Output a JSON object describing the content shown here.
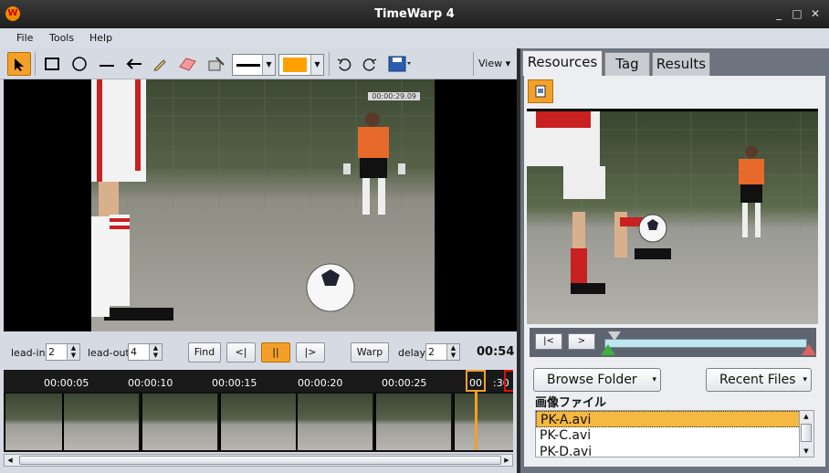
{
  "window": {
    "title": "TimeWarp 4",
    "logo_text": "W",
    "controls": [
      "_",
      "□",
      "✕"
    ]
  },
  "menu": [
    "File",
    "Tools",
    "Help"
  ],
  "toolbar": {
    "tools": [
      "select-icon",
      "rectangle-icon",
      "ellipse-icon",
      "line-icon",
      "arrow-icon",
      "pencil-icon",
      "eraser-icon",
      "clear-icon"
    ],
    "stroke_color": "#000000",
    "fill_color": "#ff9f00",
    "view_label": "View",
    "view_arrow": "▾"
  },
  "video": {
    "overlay_timestamp": "00:00:29.09"
  },
  "controls": {
    "lead_in_label": "lead-in",
    "lead_in_value": "2",
    "lead_out_label": "lead-out",
    "lead_out_value": "4",
    "find_label": "Find",
    "prev_label": "<|",
    "pause_label": "||",
    "next_label": "|>",
    "warp_label": "Warp",
    "delay_label": "delay",
    "delay_value": "2",
    "time": "00:54"
  },
  "timeline": {
    "ticks": [
      "00:00:05",
      "00:00:10",
      "00:00:15",
      "00:00:20",
      "00:00:25",
      "00",
      ":30"
    ],
    "playhead_label": "00"
  },
  "right_panel": {
    "tabs": [
      "Resources",
      "Tag",
      "Results"
    ],
    "active_tab": "Resources",
    "player": {
      "prev_label": "|<",
      "play_label": ">"
    },
    "browse_folder_label": "Browse Folder",
    "recent_files_label": "Recent Files",
    "dropdown_arrow": "▾",
    "section_title": "画像ファイル",
    "files": [
      "PK-A.avi",
      "PK-C.avi",
      "PK-D.avi"
    ],
    "selected_file": "PK-A.avi"
  }
}
